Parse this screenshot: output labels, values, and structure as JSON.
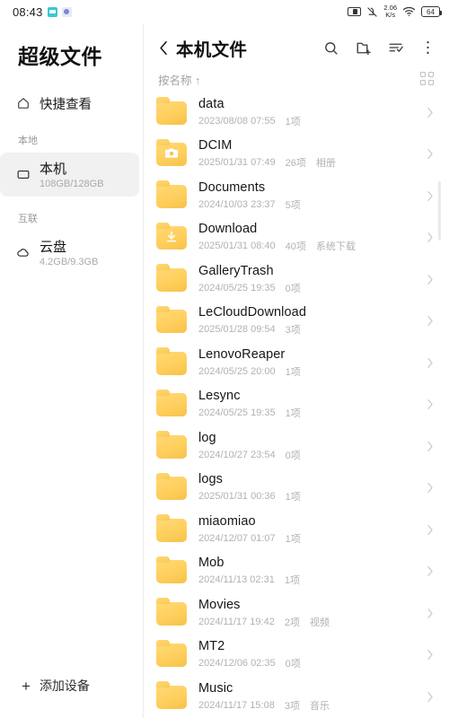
{
  "statusbar": {
    "time": "08:43",
    "app_icons": [
      "messaging-icon",
      "app-badge-icon"
    ],
    "network_speed": "2.06",
    "network_speed_unit": "K/s",
    "battery_level": "64",
    "icons": [
      "sim-card-icon",
      "mute-icon",
      "wifi-icon",
      "battery-icon"
    ]
  },
  "sidebar": {
    "app_title": "超级文件",
    "quick_view": {
      "label": "快捷查看",
      "icon": "home-icon"
    },
    "groups": [
      {
        "label": "本地",
        "items": [
          {
            "name": "本机",
            "sub": "108GB/128GB",
            "icon": "device-icon",
            "active": true
          }
        ]
      },
      {
        "label": "互联",
        "items": [
          {
            "name": "云盘",
            "sub": "4.2GB/9.3GB",
            "icon": "cloud-icon",
            "active": false
          }
        ]
      }
    ],
    "add_device": {
      "label": "添加设备",
      "icon": "plus-icon"
    }
  },
  "main": {
    "title": "本机文件",
    "back_icon": "chevron-left-icon",
    "actions": [
      {
        "name": "search-icon",
        "label": "搜索"
      },
      {
        "name": "new-folder-icon",
        "label": "新建文件夹"
      },
      {
        "name": "sort-select-icon",
        "label": "选择"
      },
      {
        "name": "more-icon",
        "label": "更多"
      }
    ],
    "sort_label": "按名称 ↑",
    "view_toggle_icon": "grid-view-icon",
    "files": [
      {
        "name": "data",
        "date": "2023/08/08 07:55",
        "count": "1项",
        "tag": "",
        "icon": "folder-icon"
      },
      {
        "name": "DCIM",
        "date": "2025/01/31 07:49",
        "count": "26项",
        "tag": "相册",
        "icon": "folder-camera-icon"
      },
      {
        "name": "Documents",
        "date": "2024/10/03 23:37",
        "count": "5项",
        "tag": "",
        "icon": "folder-icon"
      },
      {
        "name": "Download",
        "date": "2025/01/31 08:40",
        "count": "40项",
        "tag": "系统下载",
        "icon": "folder-download-icon"
      },
      {
        "name": "GalleryTrash",
        "date": "2024/05/25 19:35",
        "count": "0项",
        "tag": "",
        "icon": "folder-icon"
      },
      {
        "name": "LeCloudDownload",
        "date": "2025/01/28 09:54",
        "count": "3项",
        "tag": "",
        "icon": "folder-icon"
      },
      {
        "name": "LenovoReaper",
        "date": "2024/05/25 20:00",
        "count": "1项",
        "tag": "",
        "icon": "folder-icon"
      },
      {
        "name": "Lesync",
        "date": "2024/05/25 19:35",
        "count": "1项",
        "tag": "",
        "icon": "folder-icon"
      },
      {
        "name": "log",
        "date": "2024/10/27 23:54",
        "count": "0项",
        "tag": "",
        "icon": "folder-icon"
      },
      {
        "name": "logs",
        "date": "2025/01/31 00:36",
        "count": "1项",
        "tag": "",
        "icon": "folder-icon"
      },
      {
        "name": "miaomiao",
        "date": "2024/12/07 01:07",
        "count": "1项",
        "tag": "",
        "icon": "folder-icon"
      },
      {
        "name": "Mob",
        "date": "2024/11/13 02:31",
        "count": "1项",
        "tag": "",
        "icon": "folder-icon"
      },
      {
        "name": "Movies",
        "date": "2024/11/17 19:42",
        "count": "2项",
        "tag": "视频",
        "icon": "folder-icon"
      },
      {
        "name": "MT2",
        "date": "2024/12/06 02:35",
        "count": "0项",
        "tag": "",
        "icon": "folder-icon"
      },
      {
        "name": "Music",
        "date": "2024/11/17 15:08",
        "count": "3项",
        "tag": "音乐",
        "icon": "folder-icon"
      }
    ]
  },
  "colors": {
    "folder": "#ffd166",
    "selected_bg": "#f1f1f1",
    "meta_text": "#b2b2b2"
  }
}
